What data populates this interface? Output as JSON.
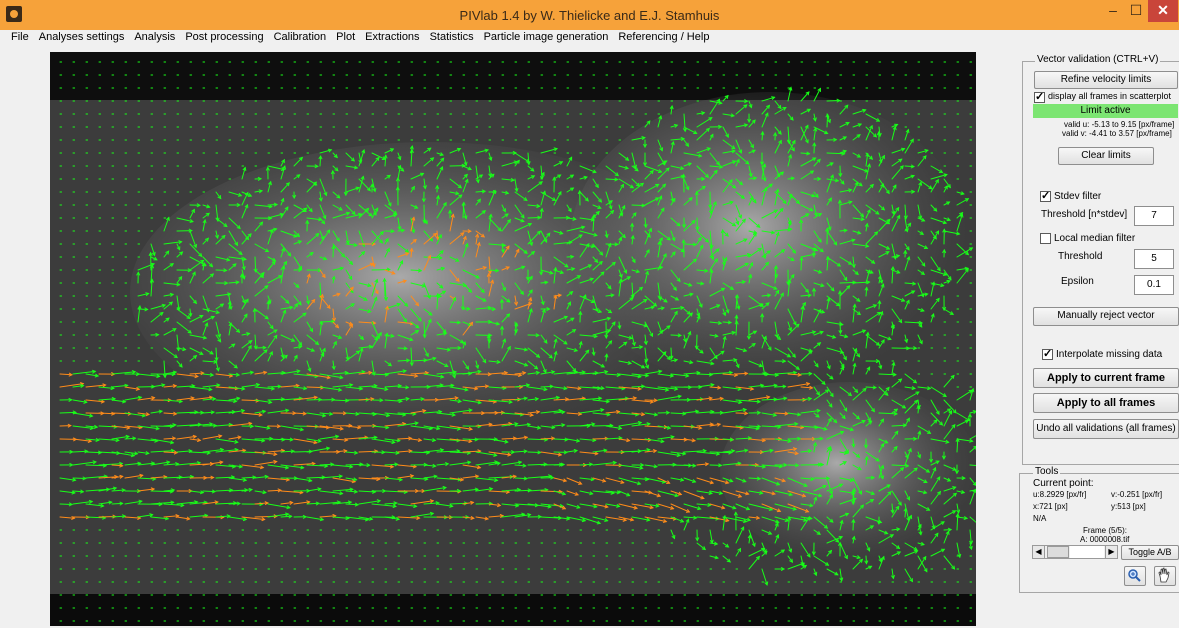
{
  "window": {
    "title": "PIVlab 1.4 by W. Thielicke and E.J. Stamhuis",
    "minimize": "–",
    "maximize": "☐",
    "close": "✕"
  },
  "menu": [
    "File",
    "Analyses settings",
    "Analysis",
    "Post processing",
    "Calibration",
    "Plot",
    "Extractions",
    "Statistics",
    "Particle image generation",
    "Referencing / Help"
  ],
  "vector_validation": {
    "legend": "Vector validation (CTRL+V)",
    "refine_button": "Refine velocity limits",
    "display_all_label": "display all frames in scatterplot",
    "display_all_checked": true,
    "limit_status": "Limit active",
    "valid_u": "valid u: -5.13 to 9.15 [px/frame]",
    "valid_v": "valid v: -4.41 to 3.57 [px/frame]",
    "clear_button": "Clear limits",
    "stdev_label": "Stdev filter",
    "stdev_checked": true,
    "threshold_stdev_label": "Threshold [n*stdev]",
    "threshold_stdev_value": "7",
    "local_median_label": "Local median filter",
    "local_median_checked": false,
    "threshold_label": "Threshold",
    "threshold_value": "5",
    "epsilon_label": "Epsilon",
    "epsilon_value": "0.1",
    "manual_reject_button": "Manually reject  vector",
    "interpolate_label": "Interpolate missing data",
    "interpolate_checked": true,
    "apply_current_button": "Apply to current frame",
    "apply_all_button": "Apply to all frames",
    "undo_button": "Undo all validations (all frames)"
  },
  "tools": {
    "legend": "Tools",
    "current_point_label": "Current point:",
    "u_value": "u:8.2929 [px/fr]",
    "v_value": "v:-0.251 [px/fr]",
    "x_value": "x:721 [px]",
    "y_value": "y:513 [px]",
    "na": "N/A",
    "frame_label": "Frame (5/5):",
    "file_label": "A: 0000008.tif",
    "toggle_button": "Toggle A/B",
    "slider_left": "◀",
    "slider_right": "▶",
    "zoom_icon": "magnifier-icon",
    "pan_icon": "hand-icon"
  },
  "colors": {
    "titlebar": "#f6a23a",
    "vector_valid": "#18ff18",
    "vector_interpolated": "#ff8c1a",
    "limit_active": "#7ce572"
  }
}
